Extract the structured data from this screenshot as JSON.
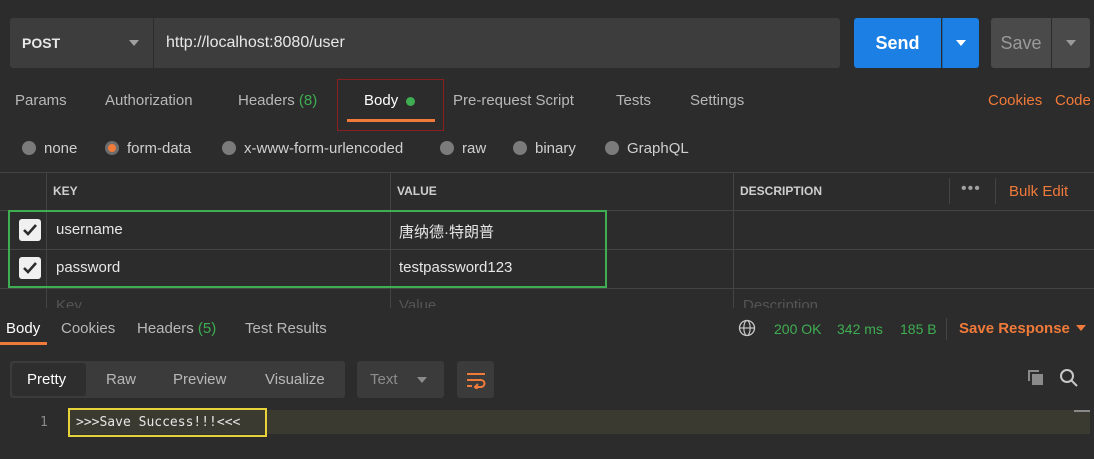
{
  "request": {
    "method": "POST",
    "url": "http://localhost:8080/user",
    "send_label": "Send",
    "save_label": "Save"
  },
  "request_tabs": {
    "params": "Params",
    "authorization": "Authorization",
    "headers": "Headers",
    "headers_count": "(8)",
    "body": "Body",
    "prerequest": "Pre-request Script",
    "tests": "Tests",
    "settings": "Settings",
    "cookies": "Cookies",
    "code": "Code"
  },
  "body_types": {
    "none": "none",
    "form_data": "form-data",
    "urlencoded": "x-www-form-urlencoded",
    "raw": "raw",
    "binary": "binary",
    "graphql": "GraphQL",
    "selected": "form-data"
  },
  "params_table": {
    "headers": [
      "KEY",
      "VALUE",
      "DESCRIPTION"
    ],
    "bulk_edit": "Bulk Edit",
    "rows": [
      {
        "key": "username",
        "value": "唐纳德·特朗普",
        "checked": true
      },
      {
        "key": "password",
        "value": "testpassword123",
        "checked": true
      }
    ],
    "placeholder": {
      "key": "Key",
      "value": "Value",
      "description": "Description"
    }
  },
  "response": {
    "tabs": {
      "body": "Body",
      "cookies": "Cookies",
      "headers": "Headers",
      "headers_count": "(5)",
      "test_results": "Test Results"
    },
    "status": "200 OK",
    "time": "342 ms",
    "size": "185 B",
    "save_response": "Save Response",
    "views": {
      "pretty": "Pretty",
      "raw": "Raw",
      "preview": "Preview",
      "visualize": "Visualize"
    },
    "format": "Text",
    "line_number": "1",
    "content": ">>>Save Success!!!<<<"
  },
  "colors": {
    "accent": "#f07a3a",
    "send": "#1b7fe3",
    "success": "#3fae52",
    "highlight_green": "#3fae52",
    "highlight_yellow": "#e8d23a",
    "highlight_red": "#8a1f1f"
  }
}
